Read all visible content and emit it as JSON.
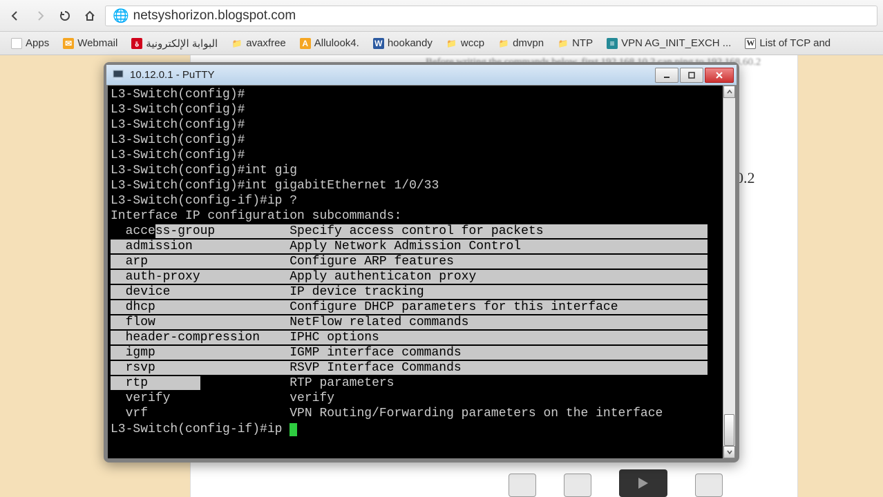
{
  "browser": {
    "url": "netsyshorizon.blogspot.com",
    "bookmarks": [
      {
        "label": "Apps",
        "icon": "grid"
      },
      {
        "label": "Webmail",
        "icon": "orange",
        "glyph": "✉"
      },
      {
        "label": "البوابة الإلكترونية",
        "icon": "red",
        "glyph": "ة"
      },
      {
        "label": "avaxfree",
        "icon": "folder"
      },
      {
        "label": "Allulook4.",
        "icon": "orange",
        "glyph": "A"
      },
      {
        "label": "hookandy",
        "icon": "blue",
        "glyph": "W"
      },
      {
        "label": "wccp",
        "icon": "folder"
      },
      {
        "label": "dmvpn",
        "icon": "folder"
      },
      {
        "label": "NTP",
        "icon": "folder"
      },
      {
        "label": "VPN AG_INIT_EXCH ...",
        "icon": "teal",
        "glyph": "≡"
      },
      {
        "label": "List of TCP and",
        "icon": "w",
        "glyph": "W"
      }
    ]
  },
  "page_bg": {
    "blurred_text": "Before writing the commands below, first 192.168.10.2 can ping to 192.168.60.2",
    "dot2": "0.2"
  },
  "putty": {
    "title": "10.12.0.1 - PuTTY",
    "prompt_config": "L3-Switch(config)#",
    "prompt_config_if": "L3-Switch(config-if)#",
    "cmd_intgig": "int gig",
    "cmd_intgig_full": "int gigabitEthernet 1/0/33",
    "cmd_ipq": "ip ?",
    "header": "Interface IP configuration subcommands:",
    "rows": [
      {
        "cmd": "access-group",
        "desc": "Specify access control for packets",
        "sel": "partial"
      },
      {
        "cmd": "admission",
        "desc": "Apply Network Admission Control",
        "sel": "full"
      },
      {
        "cmd": "arp",
        "desc": "Configure ARP features",
        "sel": "full"
      },
      {
        "cmd": "auth-proxy",
        "desc": "Apply authenticaton proxy",
        "sel": "full"
      },
      {
        "cmd": "device",
        "desc": "IP device tracking",
        "sel": "full"
      },
      {
        "cmd": "dhcp",
        "desc": "Configure DHCP parameters for this interface",
        "sel": "full"
      },
      {
        "cmd": "flow",
        "desc": "NetFlow related commands",
        "sel": "full"
      },
      {
        "cmd": "header-compression",
        "desc": "IPHC options",
        "sel": "full"
      },
      {
        "cmd": "igmp",
        "desc": "IGMP interface commands",
        "sel": "full"
      },
      {
        "cmd": "rsvp",
        "desc": "RSVP Interface Commands",
        "sel": "full"
      },
      {
        "cmd": "rtp",
        "desc": "RTP parameters",
        "sel": "cmdonly"
      },
      {
        "cmd": "verify",
        "desc": "verify",
        "sel": "none"
      },
      {
        "cmd": "vrf",
        "desc": "VPN Routing/Forwarding parameters on the interface",
        "sel": "none"
      }
    ],
    "current_cmd": "ip "
  }
}
